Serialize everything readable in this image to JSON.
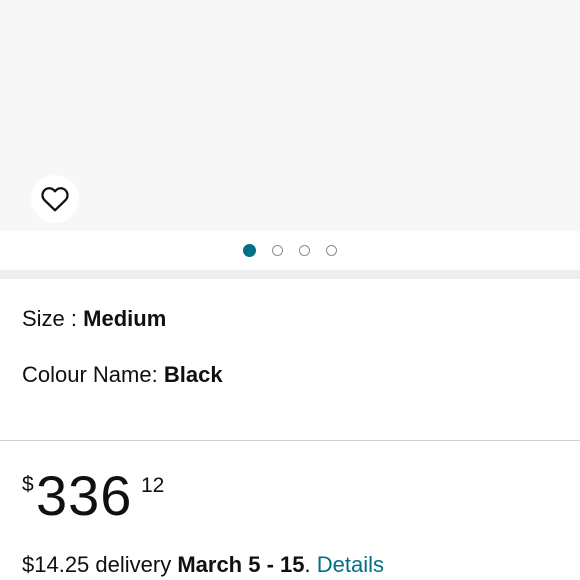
{
  "gallery": {
    "wishlist_icon": "heart-outline-icon",
    "dots": [
      {
        "active": true
      },
      {
        "active": false
      },
      {
        "active": false
      },
      {
        "active": false
      }
    ],
    "active_dot_color": "#007185"
  },
  "variations": {
    "size_label": "Size : ",
    "size_value": "Medium",
    "colour_label": "Colour Name: ",
    "colour_value": "Black"
  },
  "price": {
    "currency_symbol": "$",
    "whole": "336",
    "fraction": "12"
  },
  "delivery": {
    "prefix": "$14.25 delivery ",
    "dates": "March 5 - 15",
    "separator": ". ",
    "details_link": "Details",
    "link_color": "#007185"
  }
}
